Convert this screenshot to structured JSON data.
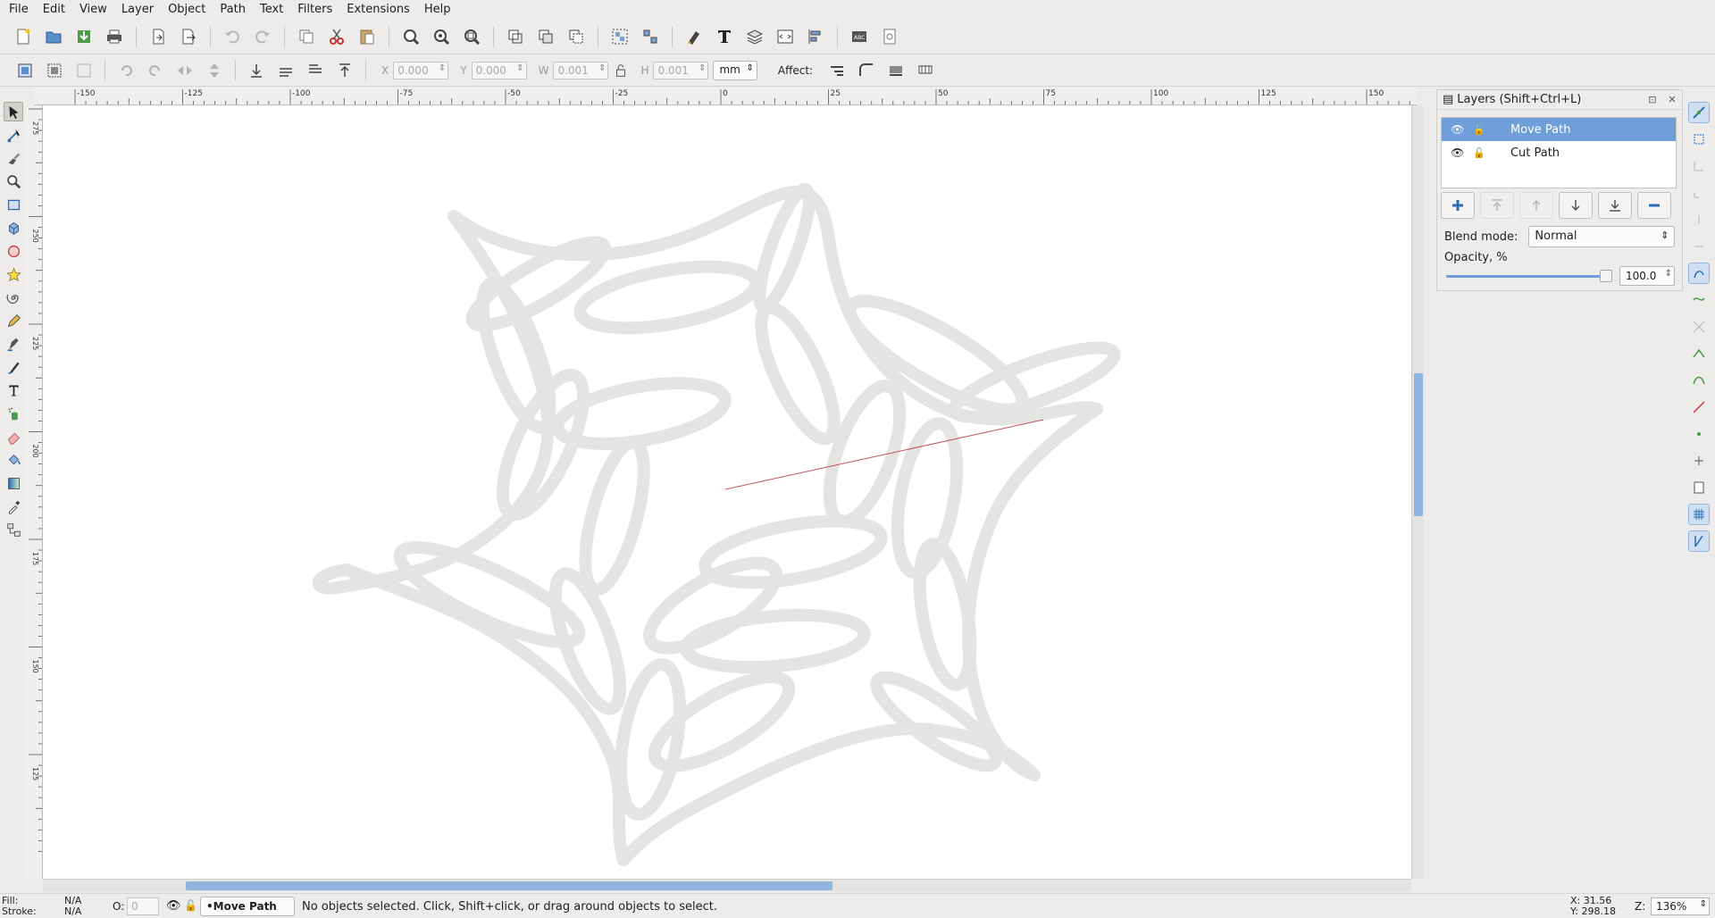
{
  "menu": [
    "File",
    "Edit",
    "View",
    "Layer",
    "Object",
    "Path",
    "Text",
    "Filters",
    "Extensions",
    "Help"
  ],
  "toolbar": {
    "x_label": "X",
    "x_value": "0.000",
    "y_label": "Y",
    "y_value": "0.000",
    "w_label": "W",
    "w_value": "0.001",
    "h_label": "H",
    "h_value": "0.001",
    "unit": "mm",
    "affect_label": "Affect:"
  },
  "ruler": {
    "h_labels": [
      "-150",
      "-125",
      "-100",
      "-75",
      "-50",
      "-25",
      "0",
      "25",
      "50",
      "75",
      "100",
      "125",
      "150"
    ],
    "v_labels": [
      "275",
      "250",
      "225",
      "200",
      "175",
      "150",
      "125"
    ]
  },
  "layers_dock": {
    "title": "Layers (Shift+Ctrl+L)",
    "layers": [
      {
        "name": "Move Path",
        "selected": true
      },
      {
        "name": "Cut Path",
        "selected": false
      }
    ],
    "blend_label": "Blend mode:",
    "blend_value": "Normal",
    "opacity_label": "Opacity, %",
    "opacity_value": "100.0"
  },
  "status": {
    "fill_label": "Fill:",
    "stroke_label": "Stroke:",
    "fill_value": "N/A",
    "stroke_value": "N/A",
    "o_label": "O:",
    "o_value": "0",
    "current_layer": "•Move Path",
    "message": "No objects selected. Click, Shift+click, or drag around objects to select.",
    "x_coord": "X:    31.56",
    "y_coord": "Y:  298.18",
    "z_label": "Z:",
    "zoom": "136%"
  },
  "colors": {
    "accent": "#6f9fd8",
    "path_stroke": "#e4e4e2",
    "cut_line": "#c0545a"
  },
  "icons": [
    "new-icon",
    "open-icon",
    "save-icon",
    "print-icon",
    "import-icon",
    "export-icon",
    "undo-icon",
    "redo-icon",
    "copy-icon",
    "cut-icon",
    "paste-icon",
    "zoom-selection-icon",
    "zoom-drawing-icon",
    "zoom-page-icon",
    "duplicate-icon",
    "clone-icon",
    "unlink-clone-icon",
    "group-icon",
    "ungroup-icon",
    "fill-stroke-icon",
    "text-icon",
    "layers-icon",
    "xml-editor-icon",
    "align-icon",
    "document-properties-icon",
    "preferences-icon"
  ]
}
